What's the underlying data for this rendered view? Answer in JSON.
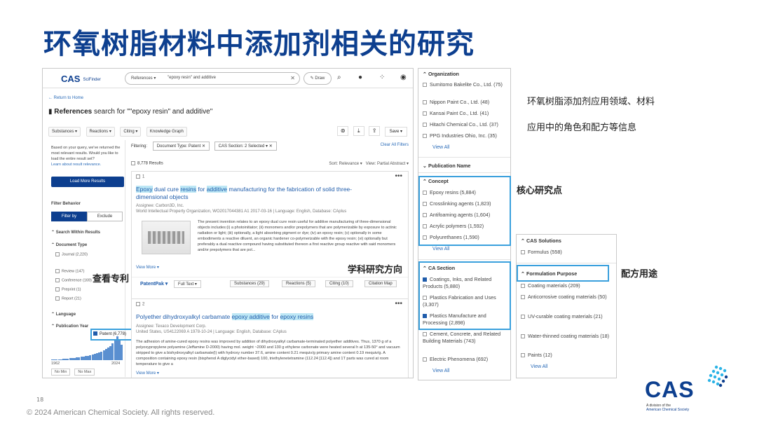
{
  "slide": {
    "title": "环氧树脂材料中添加剂相关的研究",
    "page_number": "18",
    "copyright": "© 2024 American Chemical Society. All rights reserved."
  },
  "scifinder": {
    "logo": "CAS",
    "logo_sub": "SciFinder",
    "search_scope": "References ▾",
    "search_query": "\"epoxy resin\" and additive",
    "draw_label": "Draw",
    "back_link": "← Return to Home",
    "page_heading_prefix": "References",
    "page_heading_suffix": " search for \"\"epoxy resin\" and additive\"",
    "tabs": [
      "Substances ▾",
      "Reactions ▾",
      "Citing ▾",
      "Knowledge Graph"
    ],
    "save_label": "Save ▾",
    "notice_text": "Based on your query, we've returned the most relevant results. Would you like to load the entire result set?",
    "notice_link": "Learn about result relevance.",
    "load_more": "Load More Results",
    "filter_behavior": "Filter Behavior",
    "filter_by": "Filter by",
    "exclude": "Exclude",
    "search_within": "⌃ Search Within Results",
    "document_type": "⌃ Document Type",
    "doc_types": [
      "Journal (2,220)",
      "Patent (6,778)",
      "Review (147)",
      "Conference (169)",
      "Preprint (1)",
      "Report (21)"
    ],
    "language": "⌃ Language",
    "publication_year": "⌃ Publication Year",
    "year_min": "1962",
    "year_max": "2024",
    "no_min": "No Min",
    "no_max": "No Max",
    "filtering_label": "Filtering:",
    "chip1": "Document Type: Patent ✕",
    "chip2": "CAS Section: 2 Selected ▾ ✕",
    "clear_all": "Clear All Filters",
    "results_count": "8,778 Results",
    "sort": "Sort: Relevance ▾",
    "view": "View: Partial Abstract ▾",
    "result1": {
      "num": "1",
      "title_a": "Epoxy",
      "title_b": " dual cure ",
      "title_c": "resins",
      "title_d": " for ",
      "title_e": "additive",
      "title_f": " manufacturing for the fabrication of solid three-dimensional objects",
      "assignee": "Assignee: Carbon3D, Inc.",
      "source": "World Intellectual Property Organization, WO2017044381 A1 2017-03-16 | Language: English, Database: CAplus",
      "abstract": "The present invention relates to an epoxy dual cure resin useful for additive manufacturing of three-dimensional objects includes:(i) a photoinitiator; (ii) monomers and/or prepolymers that are polymerizable by exposure to actinic radiation or light; (iii) optionally, a light absorbing pigment or dye; (iv) an epoxy resin; (v) optionally in some embodiments a reactive diluent, an organic hardener co-polymerizable with the epoxy resin; (vi) optionally but preferably a dual reactive compound having substituted thereon a first reactive group reactive with said monomers and/or prepolymers that are pol...",
      "view_more": "View More ▾",
      "patentpak": "PatentPak ▾",
      "full_text": "Full Text ▾",
      "substances": "Substances (29)",
      "reactions": "Reactions (5)",
      "citing": "Citing (10)",
      "citation_map": "Citation Map"
    },
    "result2": {
      "num": "2",
      "title_a": "Polyether dihydroxyalkyl carbamate ",
      "title_b": "epoxy additive",
      "title_c": " for ",
      "title_d": "epoxy resins",
      "assignee": "Assignee: Texaco Development Corp.",
      "source": "United States, US4122069 A 1978-10-24 | Language: English, Database: CAplus",
      "abstract": "The adhesion of amine-cured epoxy resins was improved by addition of dihydroxyalkyl carbamate-terminated polyether additives. Thus, 1370 g of a polyoxypropylene polyamine (Jeffamine D-2000) having mol. weight ~2000 and 130 g ethylene carbonate were heated several h at 135-50° and vacuum stripped to give a bishydroxyalkyl carbamate(I) with hydroxy number 37.6, amine content 0.21 mequiv/g primary amine content 0.19 mequiv/g. A composition containing epoxy resin (bisphenol A diglycidyl ether-based) 100, triethylenetetramine (112.24 [112.4]) and 1T parts was cured at room temperature to give a",
      "view_more": "View More ▾"
    }
  },
  "org_panel": {
    "organization": "⌃ Organization",
    "orgs": [
      "Sumitomo Bakelite Co., Ltd. (75)",
      "Nippon Paint Co., Ltd. (48)",
      "Kansai Paint Co., Ltd. (41)",
      "Hitachi Chemical Co., Ltd. (37)",
      "PPG Industries Ohio, Inc. (35)"
    ],
    "view_all": "View All",
    "publication_name": "⌄ Publication Name",
    "concept": "⌃ Concept",
    "concepts": [
      "Epoxy resins (5,884)",
      "Crosslinking agents (1,823)",
      "Antifoaming agents (1,604)",
      "Acrylic polymers (1,592)",
      "Polyurethanes (1,590)"
    ],
    "view_all_2": "View All",
    "cas_section": "⌃ CA Section",
    "sections": [
      "Coatings, Inks, and Related Products (5,880)",
      "Plastics Fabrication and Uses (3,307)",
      "Plastics Manufacture and Processing (2,898)",
      "Cement, Concrete, and Related Building Materials (743)",
      "Electric Phenomena (692)"
    ],
    "view_all_3": "View All"
  },
  "solutions_panel": {
    "cas_solutions": "⌃ CAS Solutions",
    "formulus": "Formulus (558)",
    "formulation_purpose": "⌃ Formulation Purpose",
    "purposes": [
      "Coating materials (209)",
      "Anticorrosive coating materials (50)",
      "UV-curable coating materials (21)",
      "Water-thinned coating materials (18)",
      "Paints (12)"
    ],
    "view_all": "View All"
  },
  "annotations": {
    "note1_line1": "环氧树脂添加剂应用领域、材料",
    "note1_line2": "应用中的角色和配方等信息",
    "core": "核心研究点",
    "direction": "学科研究方向",
    "patent": "查看专利",
    "purpose": "配方用途"
  },
  "cas_logo": {
    "word": "CAS",
    "line1": "A division of the",
    "line2": "American Chemical Society"
  },
  "colors": {
    "title_blue": "#0d3f8f",
    "highlight_box": "#3aa0dd",
    "term_highlight": "#bde7f5"
  }
}
